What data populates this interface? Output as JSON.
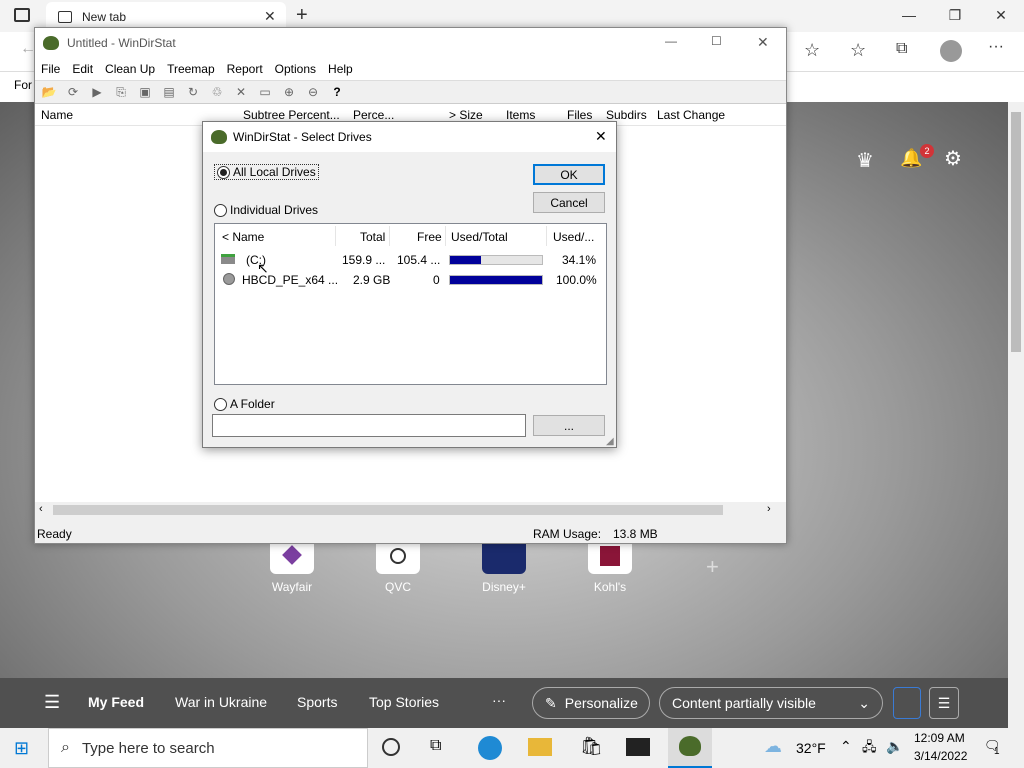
{
  "browser": {
    "tab_title": "New tab",
    "fav_text": "For",
    "feed": {
      "menu_icon": "hamburger-icon",
      "items": [
        "My Feed",
        "War in Ukraine",
        "Sports",
        "Top Stories"
      ],
      "more": "···",
      "personalize": "Personalize",
      "visibility": "Content partially visible"
    },
    "tiles": [
      "Wayfair",
      "QVC",
      "Disney+",
      "Kohl's"
    ],
    "notif_count": "2"
  },
  "wds": {
    "title": "Untitled - WinDirStat",
    "menu": [
      "File",
      "Edit",
      "Clean Up",
      "Treemap",
      "Report",
      "Options",
      "Help"
    ],
    "columns": [
      "Name",
      "Subtree Percent...",
      "Perce...",
      "> Size",
      "Items",
      "Files",
      "Subdirs",
      "Last Change"
    ],
    "status": "Ready",
    "ram_label": "RAM Usage:",
    "ram_value": "13.8 MB"
  },
  "dialog": {
    "title": "WinDirStat - Select Drives",
    "opt_all": "All Local Drives",
    "opt_individual": "Individual Drives",
    "opt_folder": "A Folder",
    "ok": "OK",
    "cancel": "Cancel",
    "browse": "...",
    "folder_value": "",
    "columns": [
      "< Name",
      "Total",
      "Free",
      "Used/Total",
      "Used/..."
    ],
    "drives": [
      {
        "name": "(C:)",
        "total": "159.9 ...",
        "free": "105.4 ...",
        "used_fraction": 0.341,
        "used_pct": "34.1%"
      },
      {
        "name": "HBCD_PE_x64 ...",
        "total": "2.9 GB",
        "free": "0",
        "used_fraction": 1.0,
        "used_pct": "100.0%"
      }
    ]
  },
  "taskbar": {
    "search_placeholder": "Type here to search",
    "weather": "32°F",
    "time": "12:09 AM",
    "date": "3/14/2022",
    "notif": "1"
  }
}
